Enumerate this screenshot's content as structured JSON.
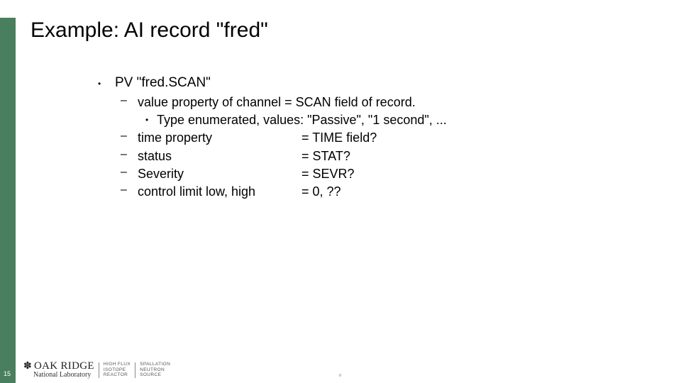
{
  "slide": {
    "title": "Example: AI record \"fred\"",
    "number": "15",
    "footer_mark": "n"
  },
  "content": {
    "bullet": {
      "text": "PV \"fred.SCAN\"",
      "subitems": [
        {
          "label": "value property of channel = SCAN field of record.",
          "value": ""
        },
        {
          "label": "time property",
          "value": "= TIME field?"
        },
        {
          "label": "status",
          "value": "= STAT?"
        },
        {
          "label": "Severity",
          "value": "= SEVR?"
        },
        {
          "label": "control limit low, high",
          "value": "= 0, ??"
        }
      ],
      "subsub": "Type enumerated, values: \"Passive\", \"1 second\", ..."
    }
  },
  "logo": {
    "org_line1": "OAK RIDGE",
    "org_line2": "National Laboratory",
    "facility1": [
      "HIGH FLUX",
      "ISOTOPE",
      "REACTOR"
    ],
    "facility2": [
      "SPALLATION",
      "NEUTRON",
      "SOURCE"
    ]
  },
  "colors": {
    "accent_green": "#4a7f5e"
  }
}
